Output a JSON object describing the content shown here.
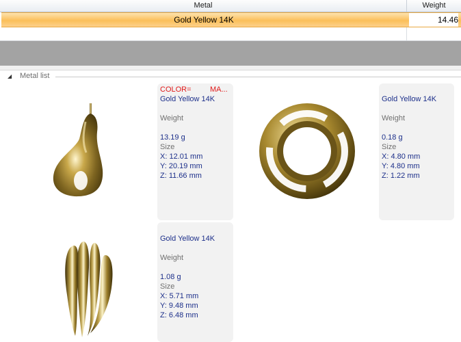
{
  "grid": {
    "columns": [
      "Metal",
      "Weight"
    ],
    "selected_row": {
      "metal": "Gold Yellow 14K",
      "weight": "14.46"
    }
  },
  "metal_list": {
    "title": "Metal list",
    "items": [
      {
        "shape": "pear-pendant",
        "color_label": "COLOR=",
        "ma_label": "MA...",
        "metal": "Gold Yellow 14K",
        "weight_label": "Weight",
        "weight": "13.19 g",
        "size_label": "Size",
        "x": "X: 12.01 mm",
        "y": "Y: 20.19 mm",
        "z": "Z: 11.66 mm"
      },
      {
        "shape": "ring",
        "metal": "Gold Yellow 14K",
        "weight_label": "Weight",
        "weight": "0.18 g",
        "size_label": "Size",
        "x": "X: 4.80 mm",
        "y": "Y: 4.80 mm",
        "z": "Z: 1.22 mm"
      },
      {
        "shape": "fluted-cap",
        "metal": "Gold Yellow 14K",
        "weight_label": "Weight",
        "weight": "1.08 g",
        "size_label": "Size",
        "x": "X: 5.71 mm",
        "y": "Y: 9.48 mm",
        "z": "Z: 6.48 mm"
      }
    ]
  },
  "colors": {
    "selection": "#fbbf5a",
    "metal_text": "#1c2f8a",
    "color_label": "#e01818"
  }
}
